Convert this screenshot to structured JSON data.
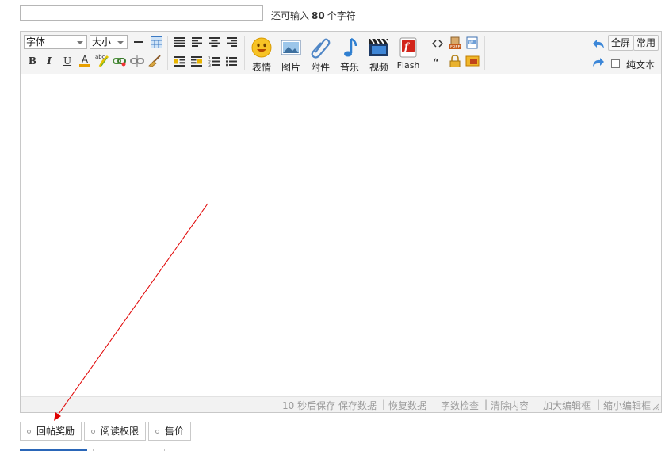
{
  "title_field": {
    "value": "",
    "placeholder": ""
  },
  "char_limit": {
    "prefix": "还可输入",
    "count": "80",
    "suffix": "个字符"
  },
  "toolbar": {
    "font_select": "字体",
    "size_select": "大小",
    "bold": "B",
    "italic": "I",
    "underline": "U",
    "font_color": "A",
    "media": [
      {
        "label": "表情",
        "icon": "smiley-icon"
      },
      {
        "label": "图片",
        "icon": "image-icon"
      },
      {
        "label": "附件",
        "icon": "paperclip-icon"
      },
      {
        "label": "音乐",
        "icon": "music-note-icon"
      },
      {
        "label": "视频",
        "icon": "video-clapper-icon"
      },
      {
        "label": "Flash",
        "icon": "flash-icon"
      }
    ],
    "fullscreen": "全屏",
    "common": "常用",
    "plain_text": "纯文本",
    "plain_text_checked": false
  },
  "statusbar": {
    "autosave": "10 秒后保存",
    "save_data": "保存数据",
    "restore_data": "恢复数据",
    "word_check": "字数检查",
    "clear_content": "清除内容",
    "enlarge": "加大编辑框",
    "shrink": "缩小编辑框",
    "sep": "|"
  },
  "options": {
    "reply_reward": "回帖奖励",
    "read_permission": "阅读权限",
    "price": "售价"
  },
  "annotation_arrow_color": "#e00000"
}
